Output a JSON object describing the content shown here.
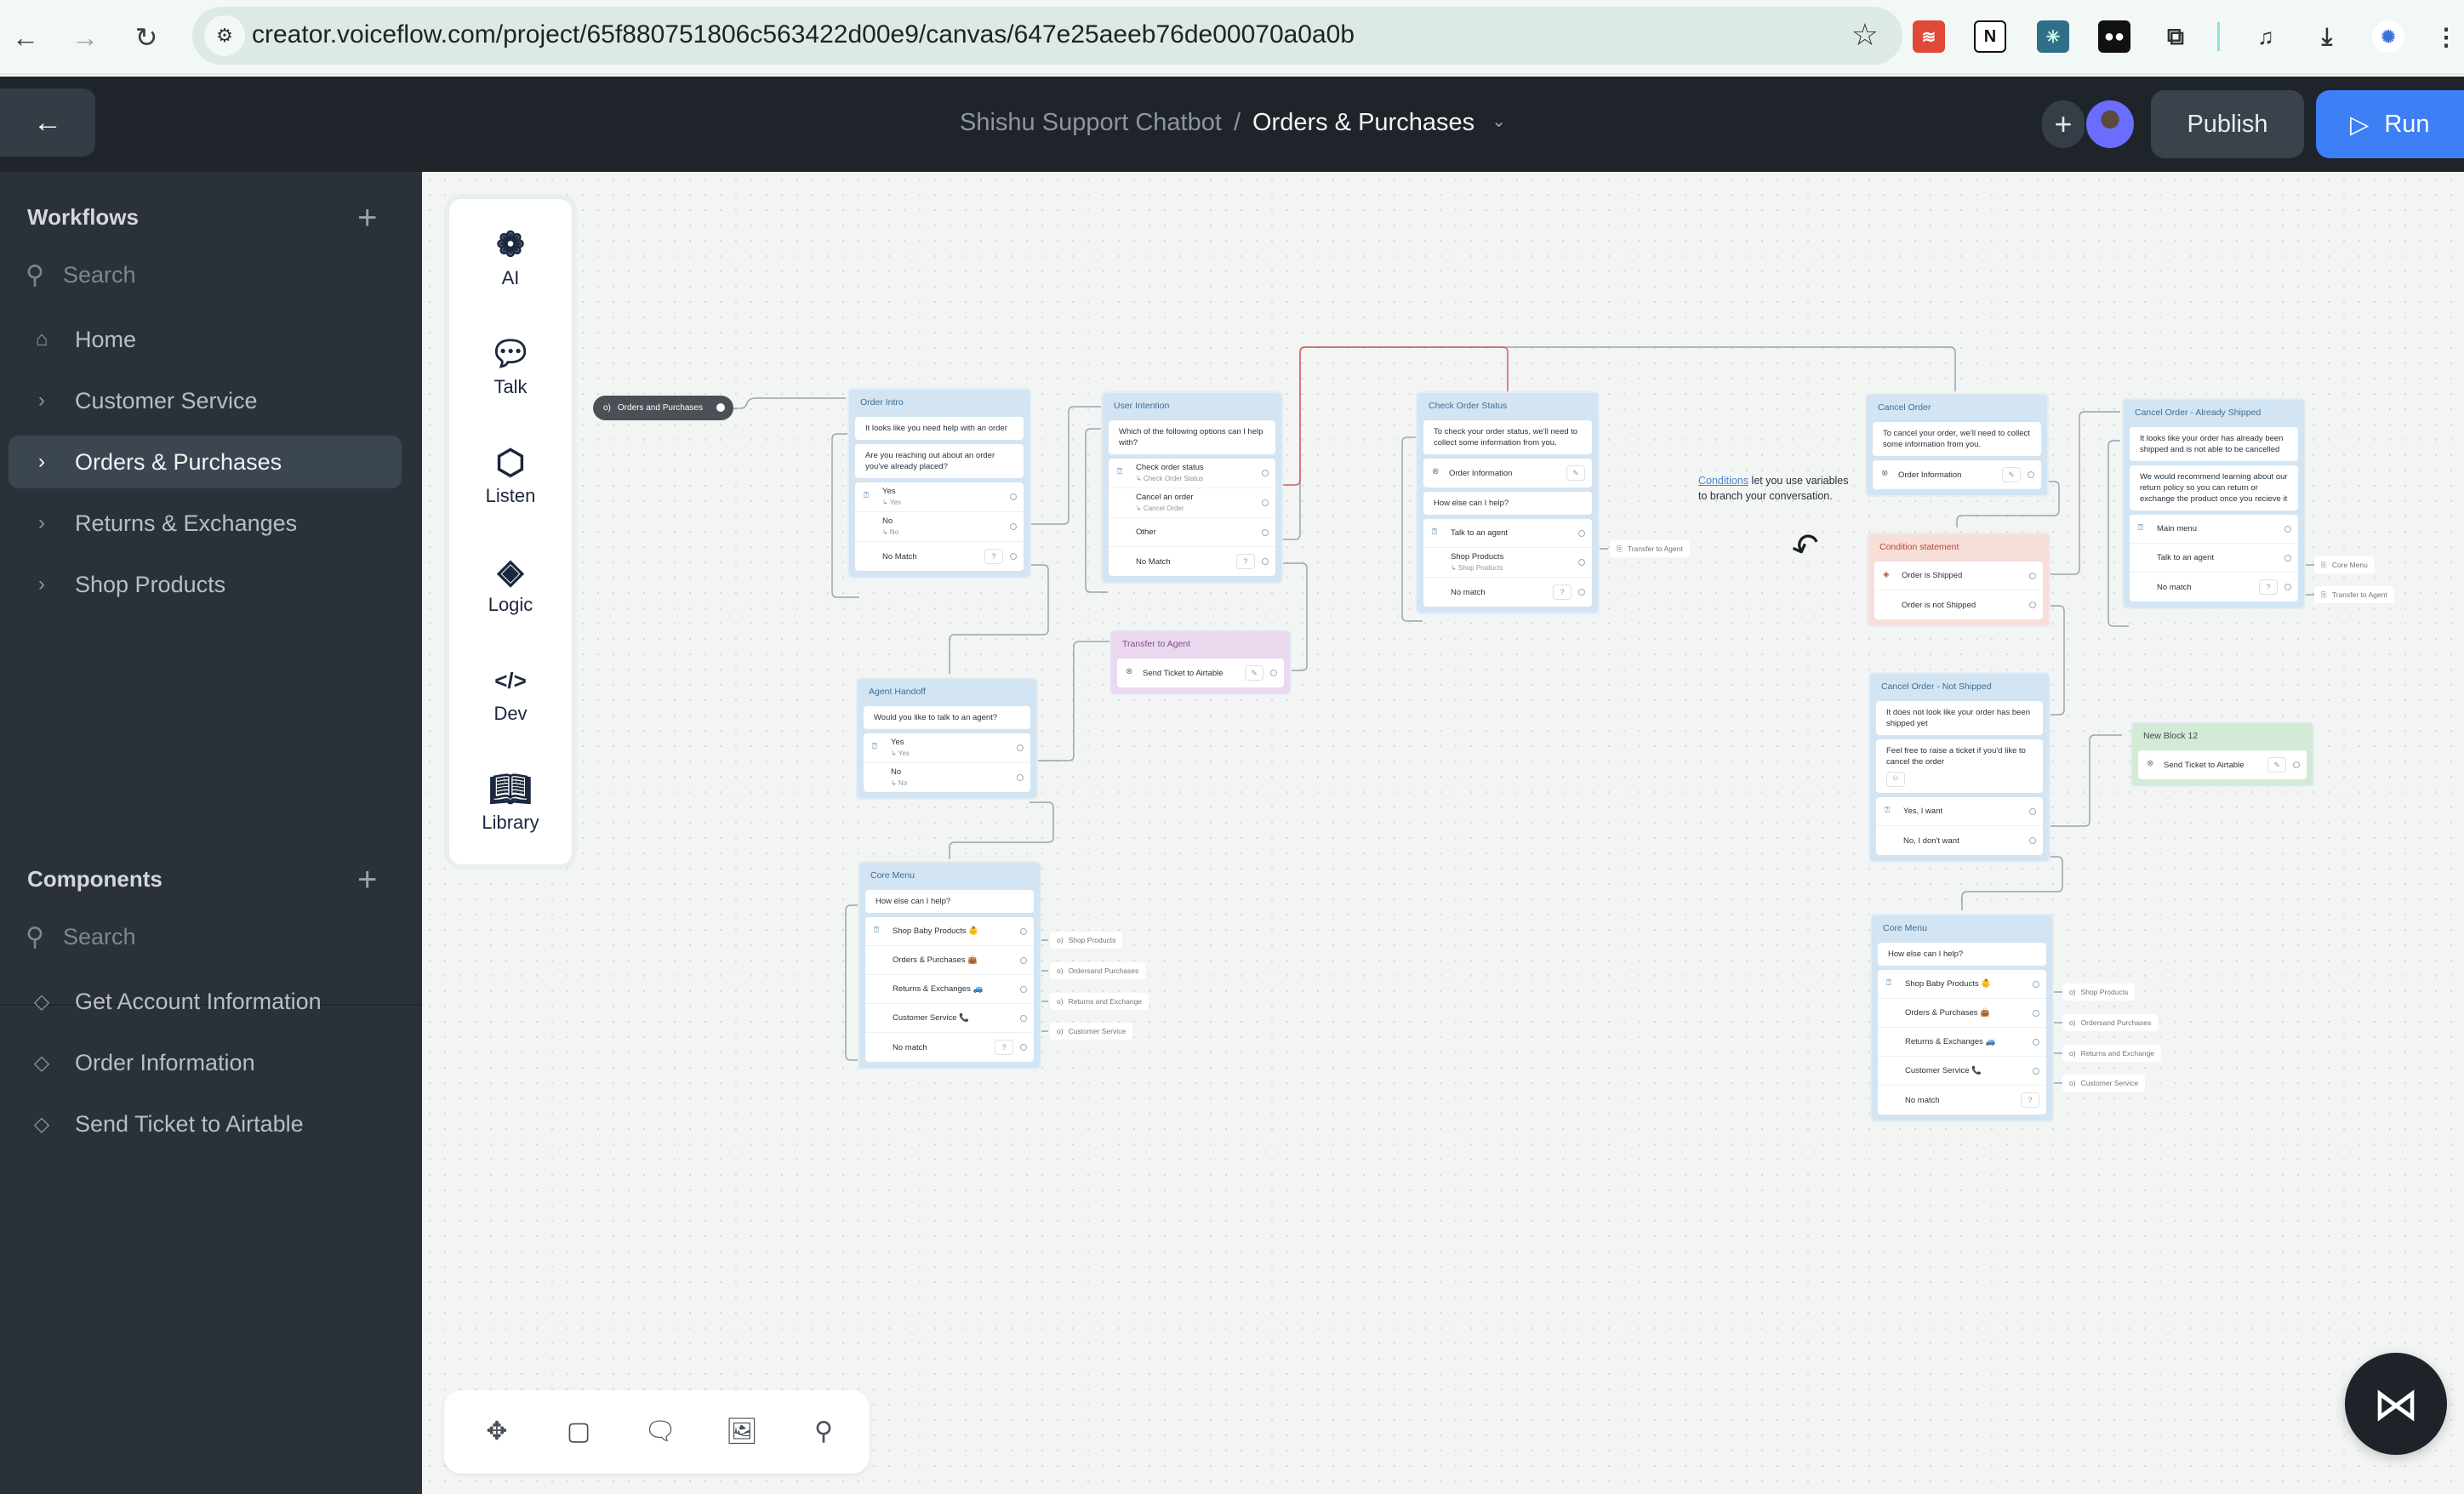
{
  "browser": {
    "url": "creator.voiceflow.com/project/65f880751806c563422d00e9/canvas/647e25aeeb76de00070a0a0b",
    "back_icon": "arrow-left-icon",
    "forward_icon": "arrow-right-icon",
    "reload_icon": "reload-icon",
    "bookmark_icon": "star-icon",
    "extensions": [
      "todoist",
      "notion",
      "perplexity",
      "roam",
      "puzzle",
      "media",
      "downloads",
      "profile"
    ]
  },
  "header": {
    "back_icon": "arrow-left-icon",
    "project": "Shishu Support Chatbot",
    "separator": "/",
    "workflow": "Orders & Purchases",
    "publish_label": "Publish",
    "run_label": "Run",
    "colors": {
      "header_bg": "#1f242b",
      "run_button": "#3d7ff5"
    }
  },
  "sidebar": {
    "workflows_title": "Workflows",
    "workflows_search": "Search",
    "workflows": [
      {
        "label": "Home",
        "icon": "home-icon"
      },
      {
        "label": "Customer Service",
        "icon": "chevron-right-icon"
      },
      {
        "label": "Orders & Purchases",
        "icon": "chevron-right-icon",
        "active": true
      },
      {
        "label": "Returns & Exchanges",
        "icon": "chevron-right-icon"
      },
      {
        "label": "Shop Products",
        "icon": "chevron-right-icon"
      }
    ],
    "components_title": "Components",
    "components_search": "Search",
    "components": [
      {
        "label": "Get Account Information",
        "icon": "component-diamond-icon"
      },
      {
        "label": "Order Information",
        "icon": "component-diamond-icon"
      },
      {
        "label": "Send Ticket to Airtable",
        "icon": "component-diamond-icon"
      }
    ]
  },
  "toolbox": [
    {
      "label": "AI",
      "icon": "openai-icon"
    },
    {
      "label": "Talk",
      "icon": "chat-bubble-icon"
    },
    {
      "label": "Listen",
      "icon": "listen-user-icon"
    },
    {
      "label": "Logic",
      "icon": "logic-diamond-icon"
    },
    {
      "label": "Dev",
      "icon": "code-icon"
    },
    {
      "label": "Library",
      "icon": "book-icon"
    }
  ],
  "bottom_toolbar": [
    "move-icon",
    "sticky-note-icon",
    "comment-icon",
    "image-icon",
    "search-icon"
  ],
  "canvas": {
    "start": "Orders and Purchases",
    "note": {
      "link": "Conditions",
      "text": " let you use variables to branch your conversation."
    },
    "blocks": {
      "order_intro": {
        "title": "Order Intro",
        "messages": [
          "It looks like you need help with an order",
          "Are you reaching out about an order you've already placed?"
        ],
        "choices": [
          {
            "label": "Yes",
            "sub": "↳ Yes"
          },
          {
            "label": "No",
            "sub": "↳ No"
          },
          {
            "label": "No Match"
          }
        ]
      },
      "user_intention": {
        "title": "User Intention",
        "messages": [
          "Which of the following options can I help with?"
        ],
        "choices": [
          {
            "label": "Check order status",
            "sub": "↳ Check Order Status"
          },
          {
            "label": "Cancel an order",
            "sub": "↳ Cancel Order"
          },
          {
            "label": "Other"
          },
          {
            "label": "No Match"
          }
        ]
      },
      "transfer_agent": {
        "title": "Transfer to Agent",
        "component": "Send Ticket to Airtable"
      },
      "agent_handoff": {
        "title": "Agent Handoff",
        "messages": [
          "Would you like to talk to an agent?"
        ],
        "choices": [
          {
            "label": "Yes",
            "sub": "↳ Yes"
          },
          {
            "label": "No",
            "sub": "↳ No"
          }
        ]
      },
      "core_menu_1": {
        "title": "Core Menu",
        "messages": [
          "How else can I help?"
        ],
        "choices": [
          {
            "label": "Shop Baby Products 👶"
          },
          {
            "label": "Orders & Purchases 👜"
          },
          {
            "label": "Returns & Exchanges 🚙"
          },
          {
            "label": "Customer Service 📞"
          },
          {
            "label": "No match"
          }
        ],
        "targets": [
          "Shop Products",
          "Ordersand Purchases",
          "Returns and Exchange",
          "Customer Service"
        ]
      },
      "check_order_status": {
        "title": "Check Order Status",
        "messages": [
          "To check your order status, we'll need to collect some information from you."
        ],
        "component": "Order Information",
        "messages2": [
          "How else can I help?"
        ],
        "choices": [
          {
            "label": "Talk to an agent"
          },
          {
            "label": "Shop Products",
            "sub": "↳ Shop Products"
          },
          {
            "label": "No match"
          }
        ],
        "targets": [
          "Transfer to Agent"
        ]
      },
      "cancel_order": {
        "title": "Cancel Order",
        "messages": [
          "To cancel your order, we'll need to collect some information from you."
        ],
        "component": "Order Information"
      },
      "condition": {
        "title": "Condition statement",
        "conditions": [
          "Order is Shipped",
          "Order is not Shipped"
        ]
      },
      "already_shipped": {
        "title": "Cancel Order - Already Shipped",
        "messages": [
          "It looks like your order has already been shipped and is not able to be cancelled",
          "We would recommend learning about our return policy so you can return or exchange the product once you recieve it"
        ],
        "choices": [
          {
            "label": "Main menu"
          },
          {
            "label": "Talk to an agent"
          },
          {
            "label": "No match"
          }
        ],
        "targets": [
          "Core Menu",
          "Transfer to Agent"
        ]
      },
      "not_shipped": {
        "title": "Cancel Order - Not Shipped",
        "messages": [
          "It does not look like your order has been shipped yet",
          "Feel free to raise a ticket if you'd like to cancel the order"
        ],
        "choices": [
          {
            "label": "Yes, I want"
          },
          {
            "label": "No, I don't want"
          }
        ]
      },
      "new_block": {
        "title": "New Block 12",
        "component": "Send Ticket to Airtable"
      },
      "core_menu_2": {
        "title": "Core Menu",
        "messages": [
          "How else can I help?"
        ],
        "choices": [
          {
            "label": "Shop Baby Products 👶"
          },
          {
            "label": "Orders & Purchases 👜"
          },
          {
            "label": "Returns & Exchanges 🚙"
          },
          {
            "label": "Customer Service 📞"
          },
          {
            "label": "No match"
          }
        ],
        "targets": [
          "Shop Products",
          "Ordersand Purchases",
          "Returns and Exchange",
          "Customer Service"
        ]
      }
    }
  }
}
